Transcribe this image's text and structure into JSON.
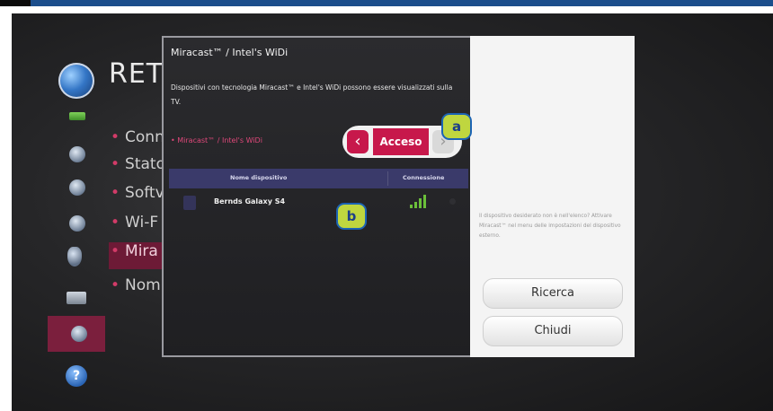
{
  "settings_menu": {
    "title": "RET",
    "items": [
      {
        "label": "Conn"
      },
      {
        "label": "Stato"
      },
      {
        "label": "Softv"
      },
      {
        "label": "Wi-F"
      },
      {
        "label": "Mira"
      },
      {
        "label": "Nom"
      }
    ],
    "selected_index": 4
  },
  "dialog": {
    "title": "Miracast™ / Intel's WiDi",
    "description": "Dispositivi con tecnologia Miracast™ e Intel's WiDi possono essere visualizzati sulla TV.",
    "setting_label": "• Miracast™ / Intel's WiDi",
    "toggle_value": "Acceso",
    "table": {
      "col_name": "Nome dispositivo",
      "col_connection": "Connessione",
      "rows": [
        {
          "name": "Bernds Galaxy S4",
          "signal_icon": "signal-strength-icon"
        }
      ]
    }
  },
  "side_panel": {
    "hint": "Il dispositivo desiderato non è nell'elenco? Attivare Miracast™ nel menu delle impostazioni del dispositivo esterno.",
    "search_label": "Ricerca",
    "close_label": "Chiudi"
  },
  "callouts": {
    "a": "a",
    "b": "b"
  },
  "colors": {
    "accent": "#c7184b",
    "callout_fill": "#bfd63f",
    "callout_border": "#1c64b4"
  }
}
